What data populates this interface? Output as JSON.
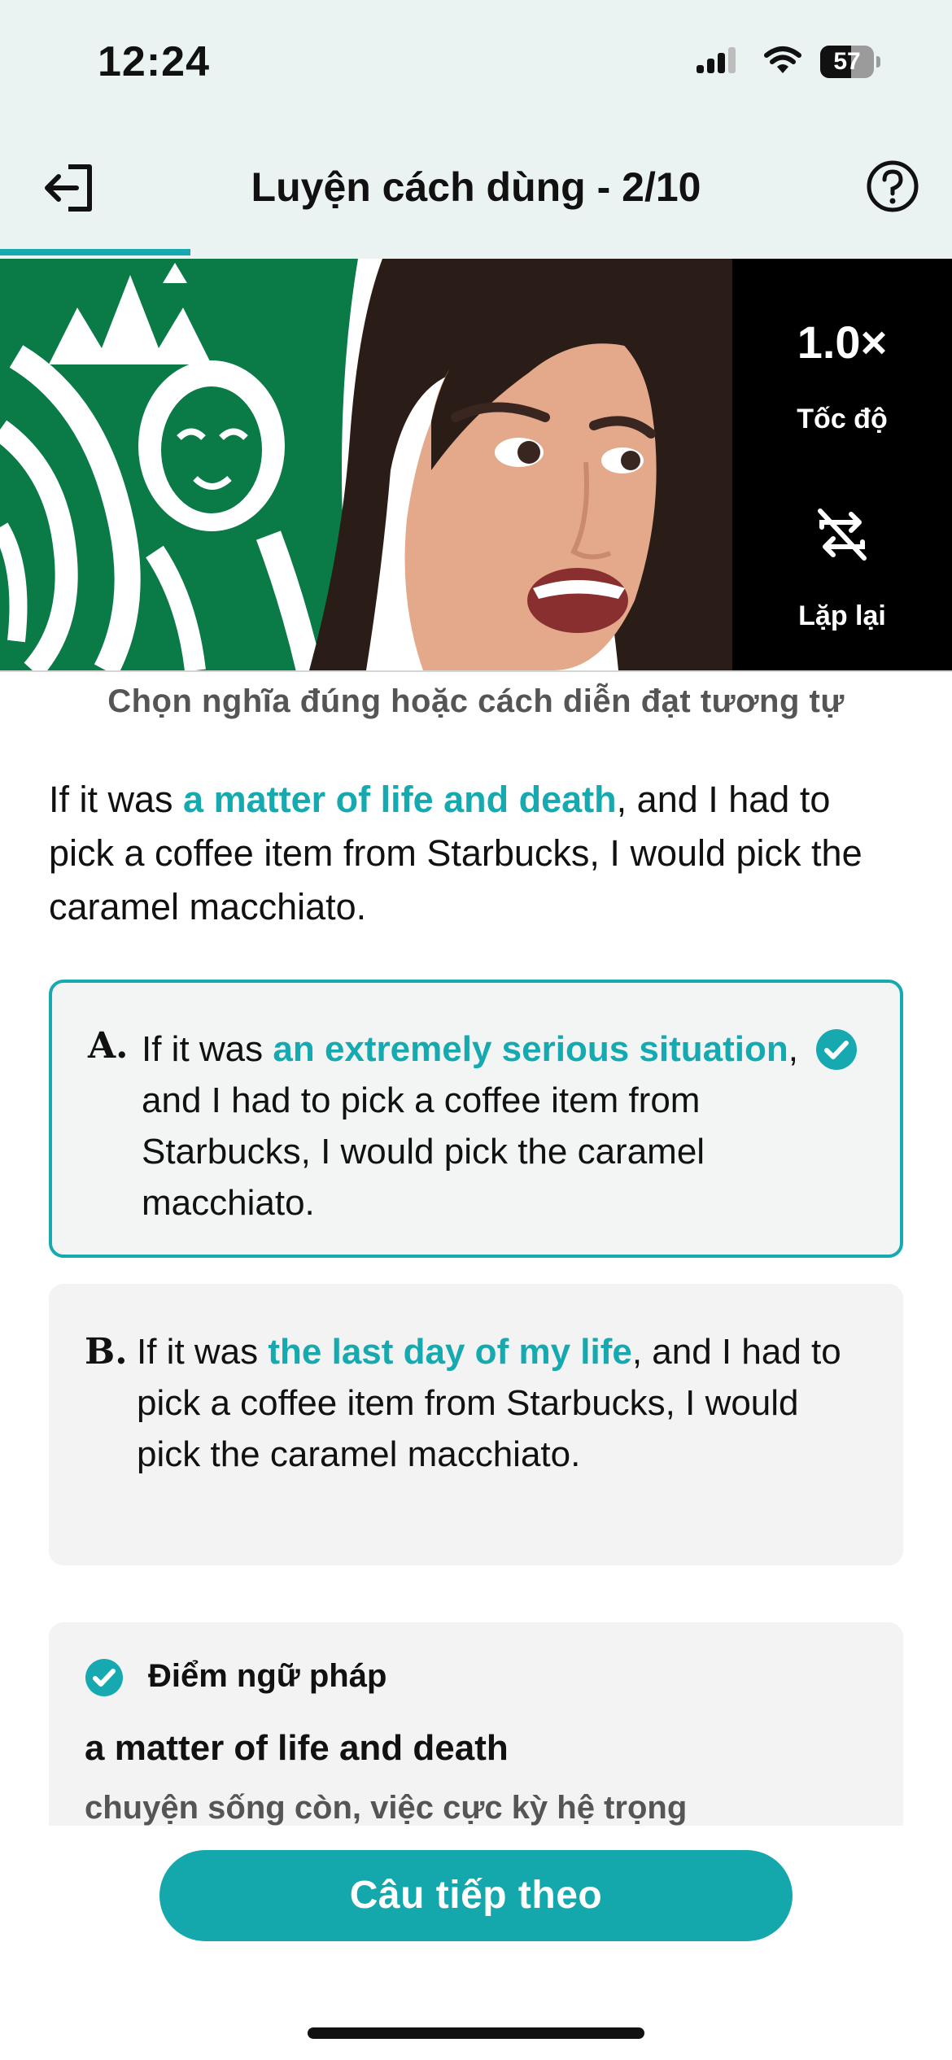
{
  "status_bar": {
    "time": "12:24",
    "battery": "57",
    "battery_level": 0.57,
    "icons": [
      "signal-icon",
      "wifi-icon",
      "battery-icon"
    ]
  },
  "header": {
    "exit_icon": "exit-icon",
    "title": "Luyện cách dùng - 2/10",
    "help_icon": "help-icon",
    "progress_fraction": 0.2
  },
  "video": {
    "speed_value": "1.0×",
    "speed_label": "Tốc độ",
    "repeat_icon": "repeat-off-icon",
    "repeat_label": "Lặp lại"
  },
  "instruction": "Chọn nghĩa đúng hoặc cách diễn đạt tương tự",
  "question": {
    "before": "If it was ",
    "highlight": "a matter of life and death",
    "after": ", and I had to pick a coffee item from Starbucks, I would pick the caramel macchiato."
  },
  "options": [
    {
      "letter": "A.",
      "before": "If it was ",
      "highlight": "an extremely serious situation",
      "after": ", and I had to pick a coffee item from Starbucks, I would pick the caramel macchiato.",
      "selected": true
    },
    {
      "letter": "B.",
      "before": "If it was ",
      "highlight": "the last day of my life",
      "after": ", and I had to pick a coffee item from Starbucks, I would pick the caramel macchiato.",
      "selected": false
    }
  ],
  "grammar": {
    "title": "Điểm ngữ pháp",
    "phrase": "a matter of life and death",
    "meaning": "chuyện sống còn, việc cực kỳ hệ trọng"
  },
  "next_button": "Câu tiếp theo",
  "colors": {
    "accent": "#16a9b0",
    "header_bg": "#ebf2f2",
    "card_bg": "#f3f3f3",
    "starbucks_green": "#0a7a47"
  }
}
